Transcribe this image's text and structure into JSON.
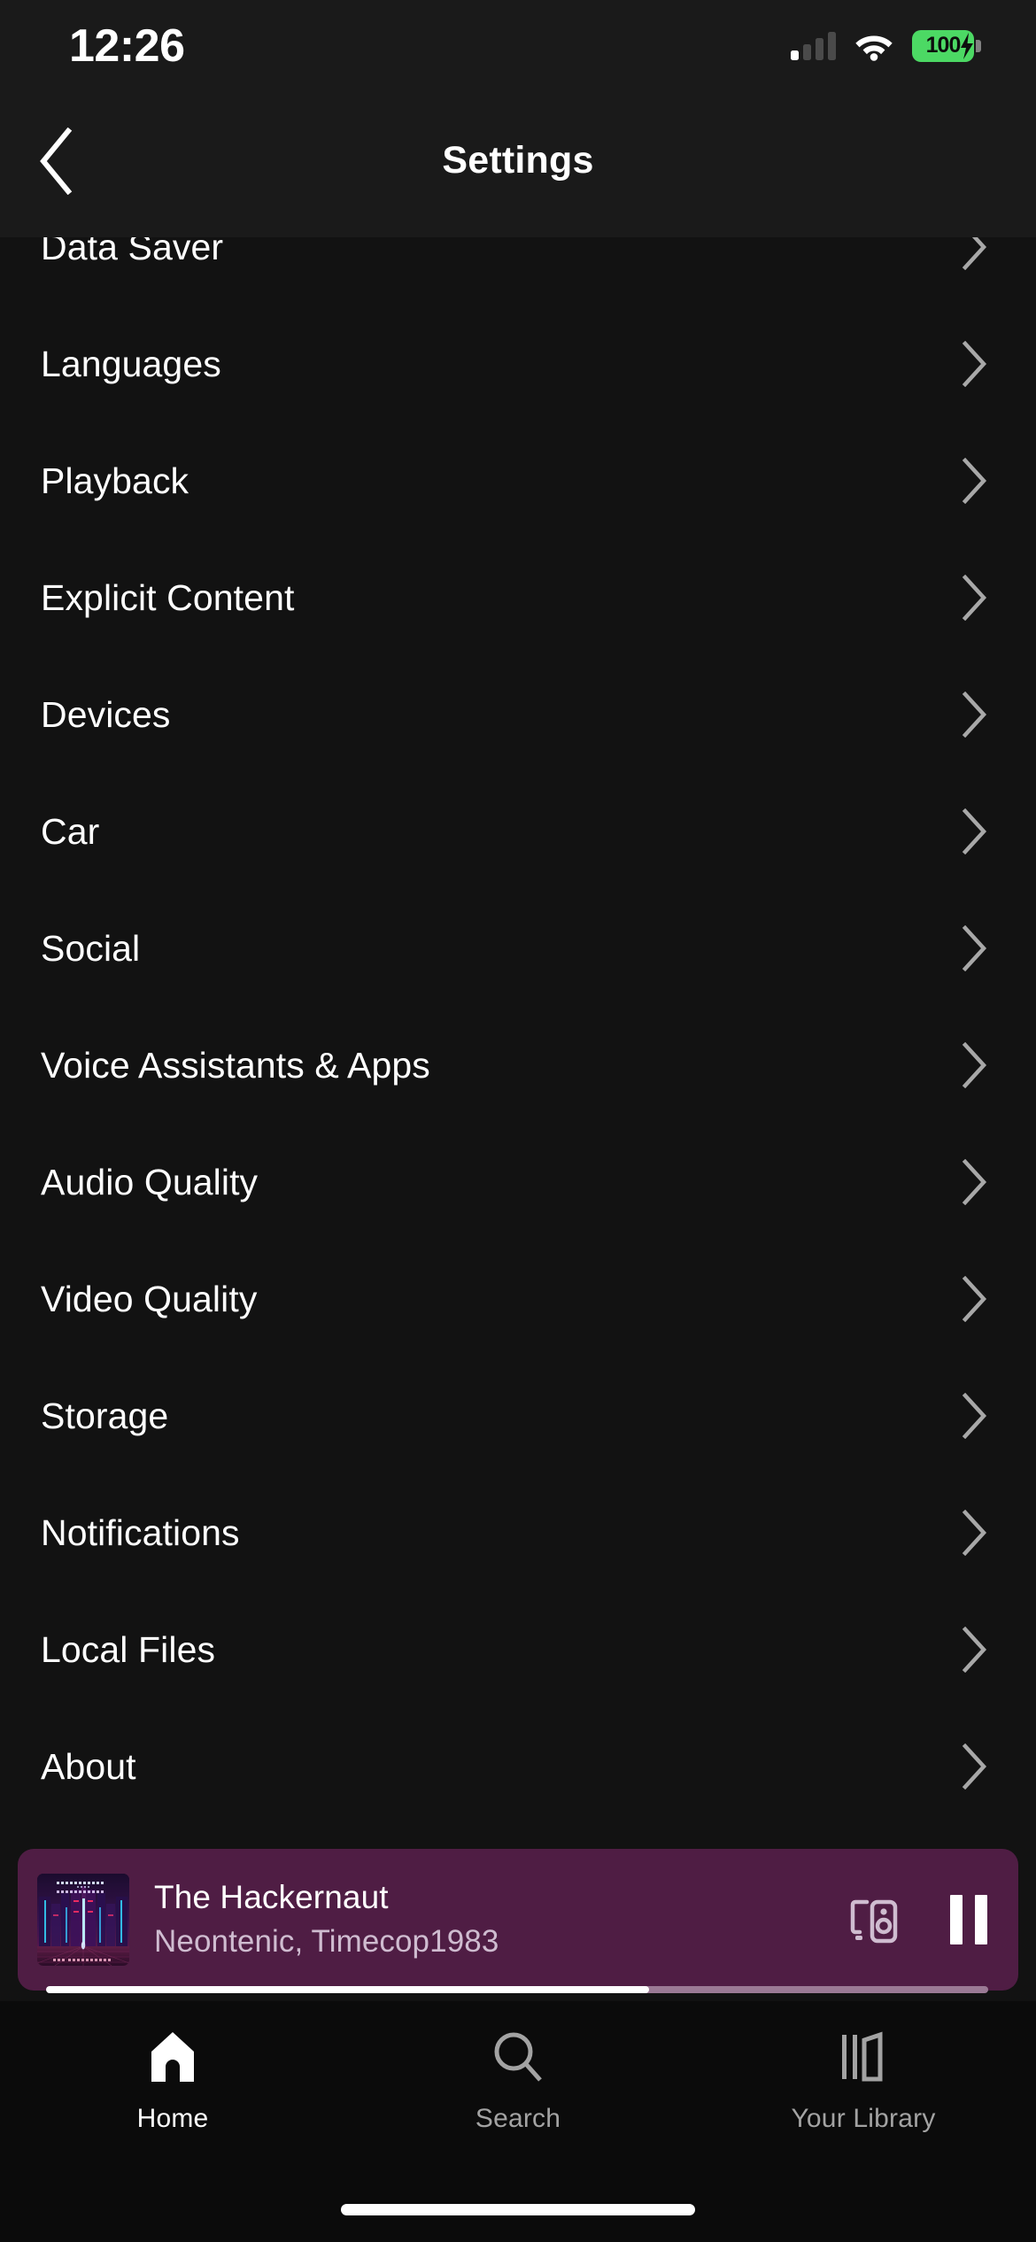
{
  "status_bar": {
    "time": "12:26",
    "battery_percent": "100",
    "cellular_icon": "cellular-signal-icon",
    "cellular_bars_filled": 1,
    "cellular_bars_total": 4,
    "wifi_icon": "wifi-icon",
    "battery_icon": "battery-charging-icon",
    "battery_color": "#4cd964"
  },
  "header": {
    "title": "Settings",
    "back_icon": "chevron-left-icon"
  },
  "settings_list": {
    "chevron_icon": "chevron-right-icon",
    "items": [
      {
        "label": "Data Saver"
      },
      {
        "label": "Languages"
      },
      {
        "label": "Playback"
      },
      {
        "label": "Explicit Content"
      },
      {
        "label": "Devices"
      },
      {
        "label": "Car"
      },
      {
        "label": "Social"
      },
      {
        "label": "Voice Assistants & Apps"
      },
      {
        "label": "Audio Quality"
      },
      {
        "label": "Video Quality"
      },
      {
        "label": "Storage"
      },
      {
        "label": "Notifications"
      },
      {
        "label": "Local Files"
      },
      {
        "label": "About"
      }
    ]
  },
  "now_playing": {
    "title": "The Hackernaut",
    "artists": "Neontenic, Timecop1983",
    "album_art_top_text": "NEONTENIC FEAT TIMECOP1983",
    "album_art_bottom_text": "THE HACKERNAUT",
    "connect_icon": "spotify-connect-device-icon",
    "play_state_icon": "pause-icon",
    "progress_percent": 64,
    "background_color": "#4f1d44"
  },
  "tab_bar": {
    "tabs": [
      {
        "label": "Home",
        "icon": "home-icon",
        "active": true
      },
      {
        "label": "Search",
        "icon": "search-icon",
        "active": false
      },
      {
        "label": "Your Library",
        "icon": "library-icon",
        "active": false
      }
    ]
  }
}
